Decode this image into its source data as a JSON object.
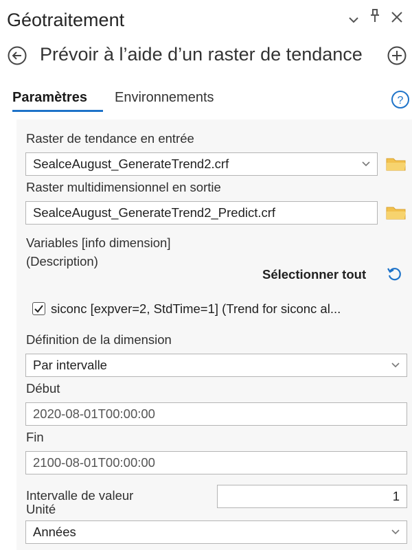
{
  "window": {
    "title": "Géotraitement",
    "controls": [
      {
        "name": "chevron-down-icon",
        "glyph": "⌄"
      },
      {
        "name": "pin-icon",
        "glyph": "ᵽ"
      },
      {
        "name": "close-icon",
        "glyph": "✕"
      }
    ]
  },
  "tool": {
    "title": "Prévoir à l’aide d’un raster de tendance",
    "back_icon": "back-arrow-icon",
    "add_icon": "add-icon"
  },
  "tabs": [
    {
      "label": "Paramètres",
      "active": true
    },
    {
      "label": "Environnements",
      "active": false
    }
  ],
  "help_icon": "help-icon",
  "params": {
    "input_raster": {
      "label": "Raster de tendance en entrée",
      "value": "SealceAugust_GenerateTrend2.crf"
    },
    "output_raster": {
      "label": "Raster multidimensionnel en sortie",
      "value": "SealceAugust_GenerateTrend2_Predict.crf"
    },
    "variables": {
      "label_line1": "Variables [info dimension]",
      "label_line2": "(Description)",
      "select_all": "Sélectionner tout",
      "items": [
        {
          "checked": true,
          "label": "siconc [expver=2, StdTime=1] (Trend for siconc al..."
        }
      ]
    },
    "dimension_def": {
      "label": "Définition de la dimension",
      "value": "Par intervalle"
    },
    "start": {
      "label": "Début",
      "value": "2020-08-01T00:00:00"
    },
    "end": {
      "label": "Fin",
      "value": "2100-08-01T00:00:00"
    },
    "interval": {
      "label": "Intervalle de valeur",
      "value": "1"
    },
    "unit": {
      "label": "Unité",
      "value": "Années"
    }
  },
  "colors": {
    "accent": "#1e73c9",
    "folder": "#f2c14e",
    "panel_bg": "#f7f7f7"
  }
}
